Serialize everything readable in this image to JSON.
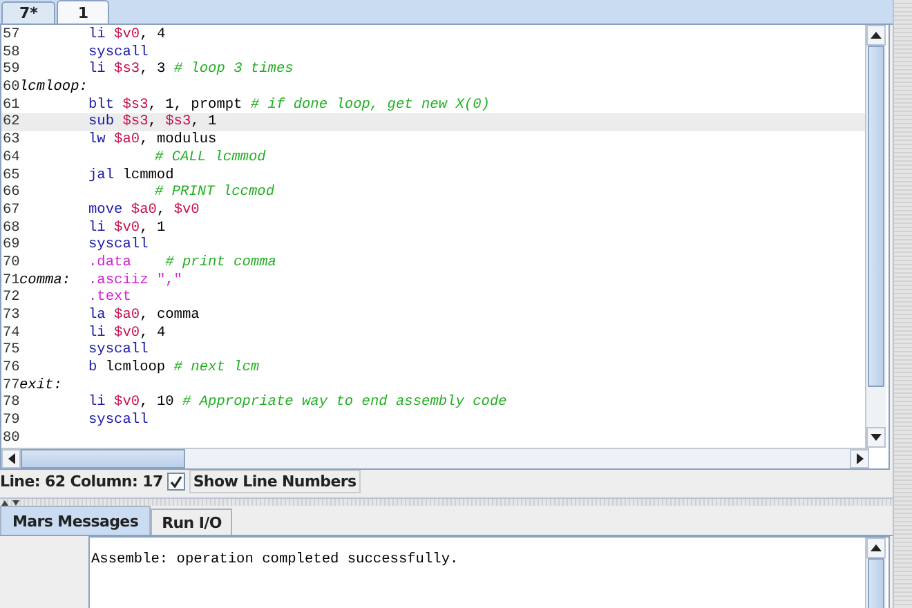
{
  "editor_tabs": [
    {
      "label": "7*",
      "selected": false
    },
    {
      "label": "1",
      "selected": true
    }
  ],
  "code_lines": [
    {
      "number": "57",
      "current": false,
      "indented": false,
      "tokens": [
        {
          "kind": "instr",
          "text": "li "
        },
        {
          "kind": "reg",
          "text": "$v0"
        },
        {
          "kind": "plain",
          "text": ", 4"
        }
      ]
    },
    {
      "number": "58",
      "current": false,
      "indented": false,
      "tokens": [
        {
          "kind": "instr",
          "text": "syscall"
        }
      ]
    },
    {
      "number": "59",
      "current": false,
      "indented": false,
      "tokens": [
        {
          "kind": "instr",
          "text": "li "
        },
        {
          "kind": "reg",
          "text": "$s3"
        },
        {
          "kind": "plain",
          "text": ", 3 "
        },
        {
          "kind": "comment",
          "text": "# loop 3 times"
        }
      ]
    },
    {
      "number": "60",
      "current": false,
      "indented": false,
      "label": "lcmloop:"
    },
    {
      "number": "61",
      "current": false,
      "indented": false,
      "tokens": [
        {
          "kind": "instr",
          "text": "blt "
        },
        {
          "kind": "reg",
          "text": "$s3"
        },
        {
          "kind": "plain",
          "text": ", 1, prompt "
        },
        {
          "kind": "comment",
          "text": "# if done loop, get new X(0)"
        }
      ]
    },
    {
      "number": "62",
      "current": true,
      "indented": false,
      "tokens": [
        {
          "kind": "instr",
          "text": "sub "
        },
        {
          "kind": "reg",
          "text": "$s3"
        },
        {
          "kind": "plain",
          "text": ", "
        },
        {
          "kind": "reg",
          "text": "$s3"
        },
        {
          "kind": "plain",
          "text": ", 1"
        }
      ]
    },
    {
      "number": "63",
      "current": false,
      "indented": false,
      "tokens": [
        {
          "kind": "instr",
          "text": "lw "
        },
        {
          "kind": "reg",
          "text": "$a0"
        },
        {
          "kind": "plain",
          "text": ", modulus"
        }
      ]
    },
    {
      "number": "64",
      "current": false,
      "indented": true,
      "tokens": [
        {
          "kind": "comment",
          "text": "# CALL lcmmod"
        }
      ]
    },
    {
      "number": "65",
      "current": false,
      "indented": false,
      "tokens": [
        {
          "kind": "instr",
          "text": "jal "
        },
        {
          "kind": "plain",
          "text": "lcmmod"
        }
      ]
    },
    {
      "number": "66",
      "current": false,
      "indented": true,
      "tokens": [
        {
          "kind": "comment",
          "text": "# PRINT lccmod"
        }
      ]
    },
    {
      "number": "67",
      "current": false,
      "indented": false,
      "tokens": [
        {
          "kind": "instr",
          "text": "move "
        },
        {
          "kind": "reg",
          "text": "$a0"
        },
        {
          "kind": "plain",
          "text": ", "
        },
        {
          "kind": "reg",
          "text": "$v0"
        }
      ]
    },
    {
      "number": "68",
      "current": false,
      "indented": false,
      "tokens": [
        {
          "kind": "instr",
          "text": "li "
        },
        {
          "kind": "reg",
          "text": "$v0"
        },
        {
          "kind": "plain",
          "text": ", 1"
        }
      ]
    },
    {
      "number": "69",
      "current": false,
      "indented": false,
      "tokens": [
        {
          "kind": "instr",
          "text": "syscall"
        }
      ]
    },
    {
      "number": "70",
      "current": false,
      "indented": false,
      "tokens": [
        {
          "kind": "directive",
          "text": ".data    "
        },
        {
          "kind": "comment",
          "text": "# print comma"
        }
      ]
    },
    {
      "number": "71",
      "current": false,
      "indented": false,
      "label": "comma:",
      "tokens": [
        {
          "kind": "directive",
          "text": ".asciiz "
        },
        {
          "kind": "string",
          "text": "\",\""
        }
      ]
    },
    {
      "number": "72",
      "current": false,
      "indented": false,
      "tokens": [
        {
          "kind": "directive",
          "text": ".text"
        }
      ]
    },
    {
      "number": "73",
      "current": false,
      "indented": false,
      "tokens": [
        {
          "kind": "instr",
          "text": "la "
        },
        {
          "kind": "reg",
          "text": "$a0"
        },
        {
          "kind": "plain",
          "text": ", comma"
        }
      ]
    },
    {
      "number": "74",
      "current": false,
      "indented": false,
      "tokens": [
        {
          "kind": "instr",
          "text": "li "
        },
        {
          "kind": "reg",
          "text": "$v0"
        },
        {
          "kind": "plain",
          "text": ", 4"
        }
      ]
    },
    {
      "number": "75",
      "current": false,
      "indented": false,
      "tokens": [
        {
          "kind": "instr",
          "text": "syscall"
        }
      ]
    },
    {
      "number": "76",
      "current": false,
      "indented": false,
      "tokens": [
        {
          "kind": "instr",
          "text": "b "
        },
        {
          "kind": "plain",
          "text": "lcmloop "
        },
        {
          "kind": "comment",
          "text": "# next lcm"
        }
      ]
    },
    {
      "number": "77",
      "current": false,
      "indented": false,
      "label": "exit:"
    },
    {
      "number": "78",
      "current": false,
      "indented": false,
      "tokens": [
        {
          "kind": "instr",
          "text": "li "
        },
        {
          "kind": "reg",
          "text": "$v0"
        },
        {
          "kind": "plain",
          "text": ", 10 "
        },
        {
          "kind": "comment",
          "text": "# Appropriate way to end assembly code"
        }
      ]
    },
    {
      "number": "79",
      "current": false,
      "indented": false,
      "tokens": [
        {
          "kind": "instr",
          "text": "syscall"
        }
      ]
    },
    {
      "number": "80",
      "current": false
    }
  ],
  "status": {
    "position": "Line: 62 Column: 17",
    "show_line_numbers": {
      "label": "Show Line Numbers",
      "checked": true
    }
  },
  "message_tabs": [
    {
      "label": "Mars Messages",
      "selected": true
    },
    {
      "label": "Run I/O",
      "selected": false
    }
  ],
  "messages": [
    "Assemble: operation completed successfully."
  ]
}
